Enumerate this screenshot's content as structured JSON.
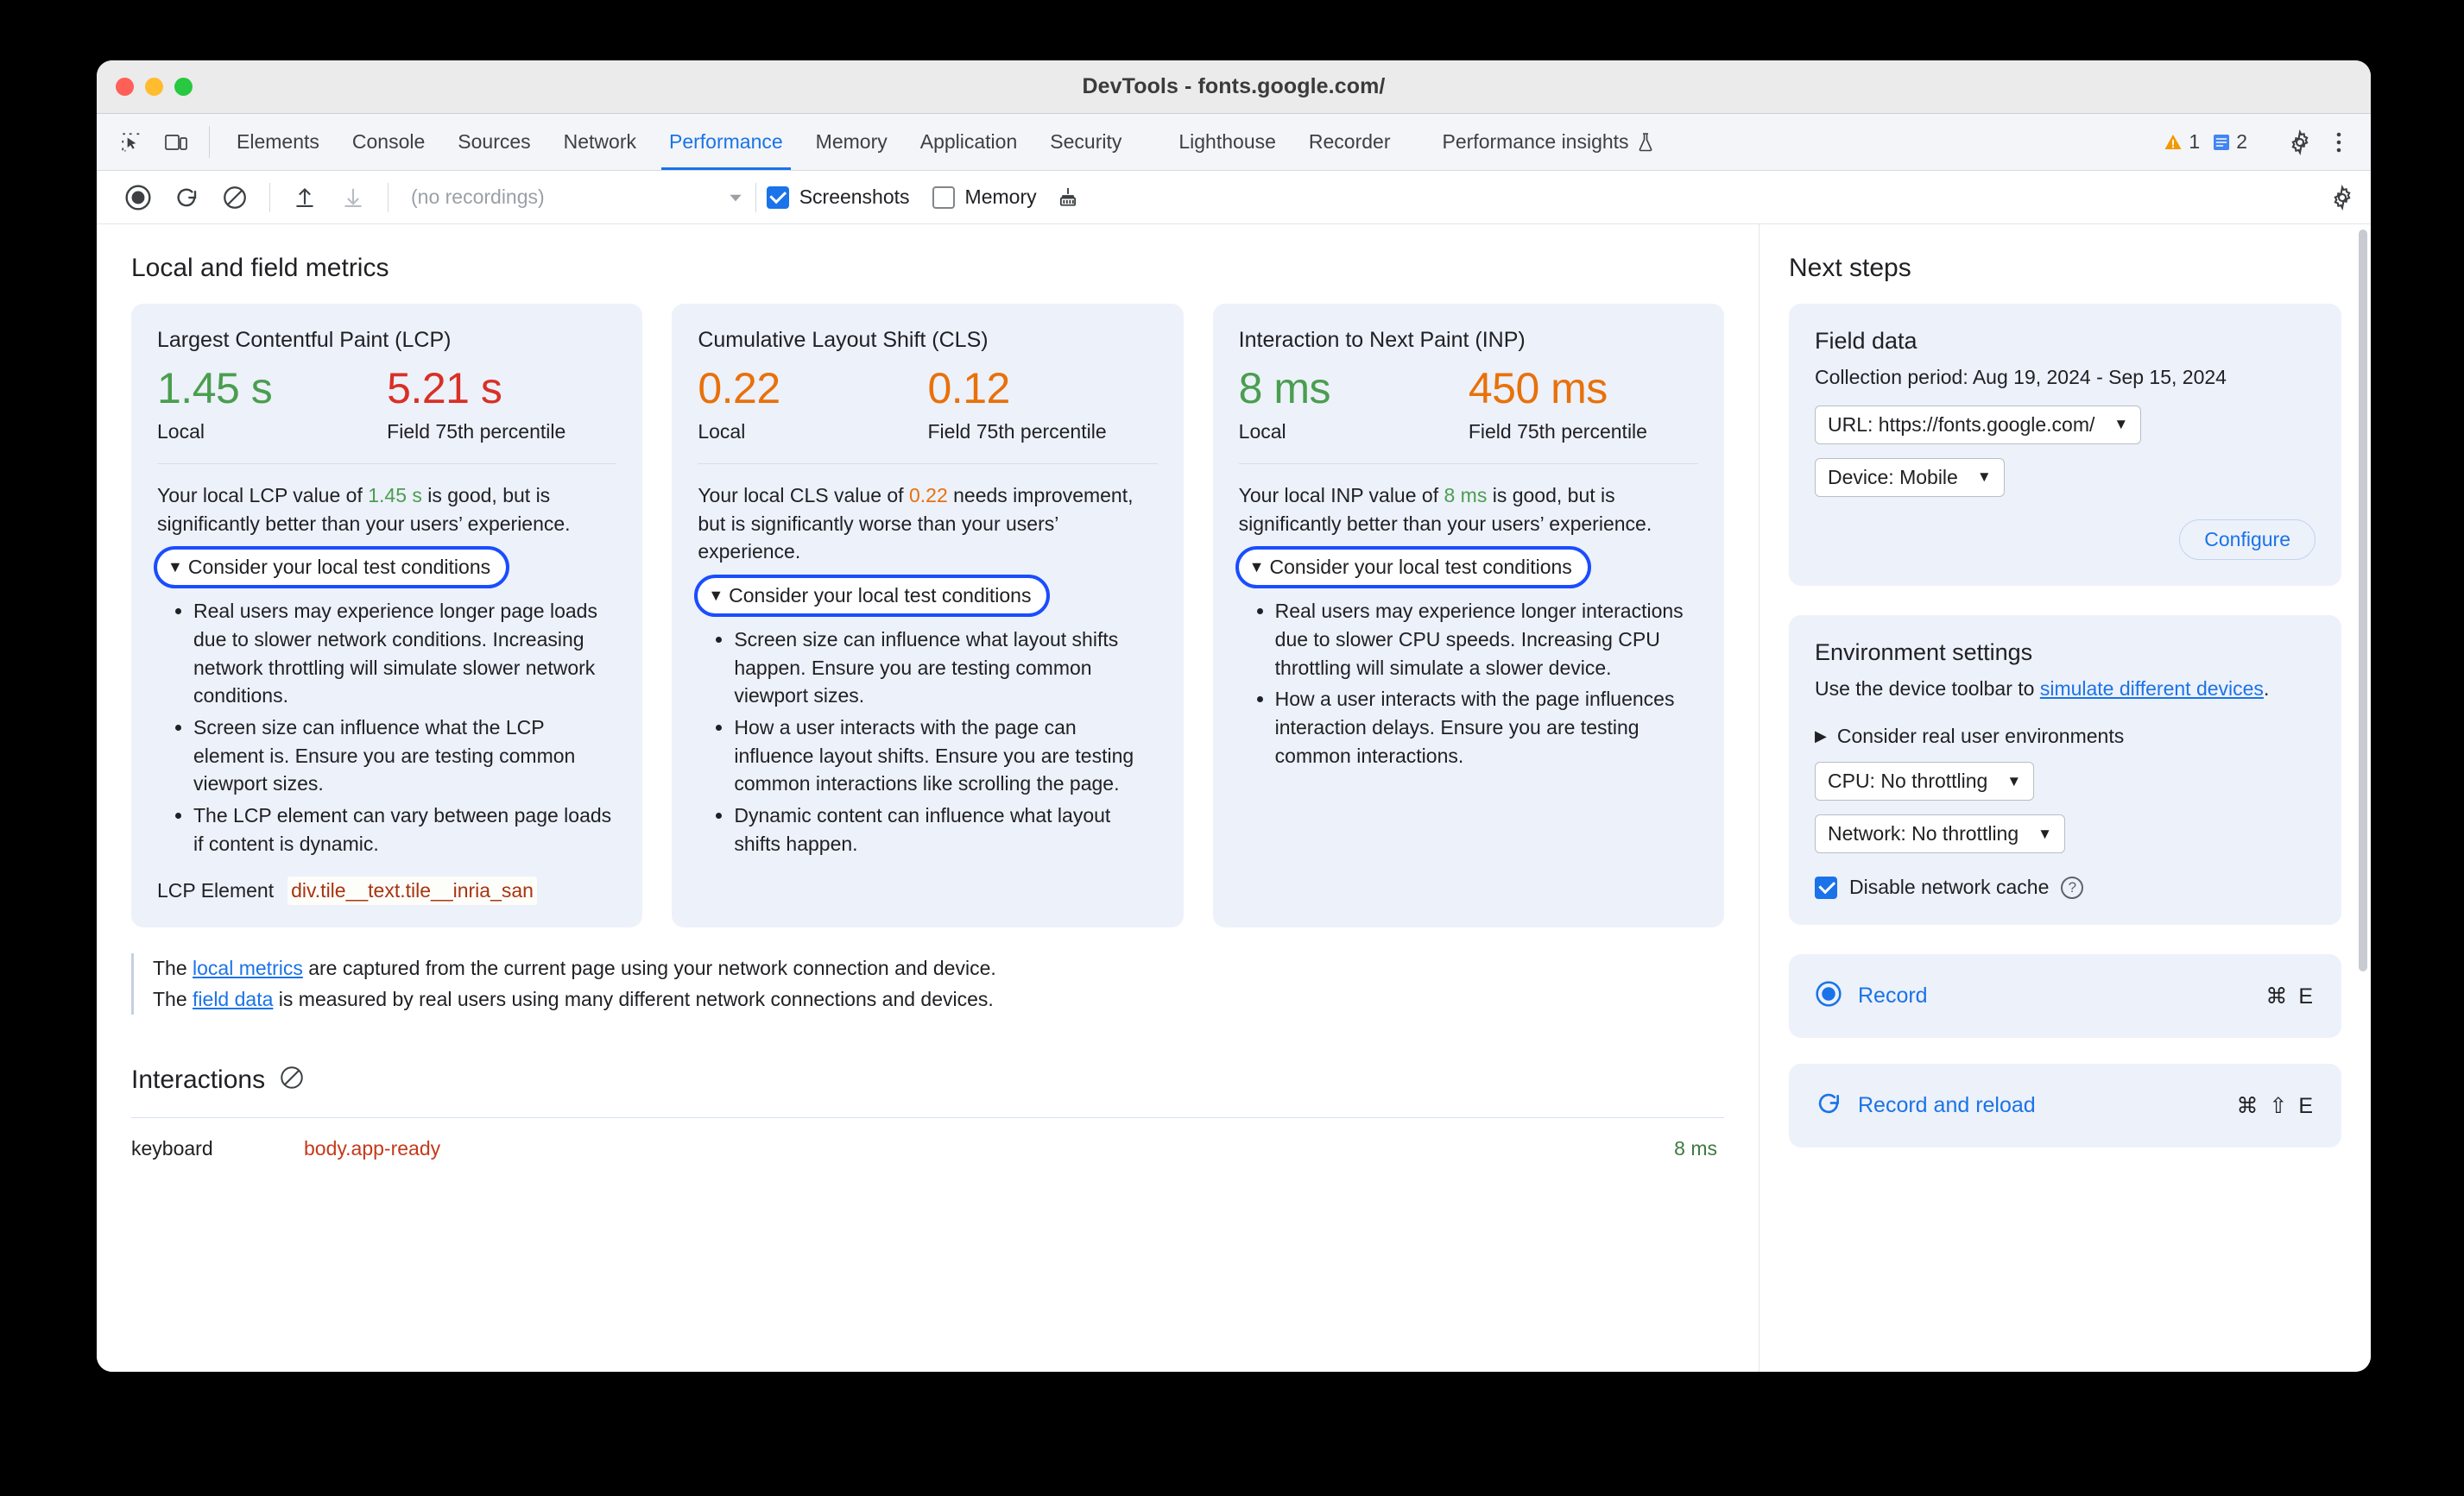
{
  "window": {
    "title": "DevTools - fonts.google.com/"
  },
  "tabs": {
    "items": [
      {
        "label": "Elements",
        "active": false
      },
      {
        "label": "Console",
        "active": false
      },
      {
        "label": "Sources",
        "active": false
      },
      {
        "label": "Network",
        "active": false
      },
      {
        "label": "Performance",
        "active": true
      },
      {
        "label": "Memory",
        "active": false
      },
      {
        "label": "Application",
        "active": false
      },
      {
        "label": "Security",
        "active": false
      },
      {
        "label": "Lighthouse",
        "active": false
      },
      {
        "label": "Recorder",
        "active": false
      },
      {
        "label": "Performance insights",
        "active": false
      }
    ],
    "warning_count": "1",
    "info_count": "2"
  },
  "toolbar": {
    "recordings_placeholder": "(no recordings)",
    "screenshots_label": "Screenshots",
    "screenshots_checked": true,
    "memory_label": "Memory",
    "memory_checked": false
  },
  "main": {
    "section_title": "Local and field metrics",
    "cards": [
      {
        "title": "Largest Contentful Paint (LCP)",
        "local_value": "1.45 s",
        "local_status": "good",
        "local_label": "Local",
        "field_value": "5.21 s",
        "field_status": "bad",
        "field_label": "Field 75th percentile",
        "desc_pre": "Your local LCP value of ",
        "desc_metric": "1.45 s",
        "desc_post": " is good, but is significantly better than your users’ experience.",
        "conditions_summary": "Consider your local test conditions",
        "conditions": [
          "Real users may experience longer page loads due to slower network conditions. Increasing network throttling will simulate slower network conditions.",
          "Screen size can influence what the LCP element is. Ensure you are testing common viewport sizes.",
          "The LCP element can vary between page loads if content is dynamic."
        ],
        "element_label": "LCP Element",
        "element_value": "div.tile__text.tile__inria_san"
      },
      {
        "title": "Cumulative Layout Shift (CLS)",
        "local_value": "0.22",
        "local_status": "warn",
        "local_label": "Local",
        "field_value": "0.12",
        "field_status": "warn",
        "field_label": "Field 75th percentile",
        "desc_pre": "Your local CLS value of ",
        "desc_metric": "0.22",
        "desc_post": " needs improvement, but is significantly worse than your users’ experience.",
        "conditions_summary": "Consider your local test conditions",
        "conditions": [
          "Screen size can influence what layout shifts happen. Ensure you are testing common viewport sizes.",
          "How a user interacts with the page can influence layout shifts. Ensure you are testing common interactions like scrolling the page.",
          "Dynamic content can influence what layout shifts happen."
        ]
      },
      {
        "title": "Interaction to Next Paint (INP)",
        "local_value": "8 ms",
        "local_status": "good",
        "local_label": "Local",
        "field_value": "450 ms",
        "field_status": "warn",
        "field_label": "Field 75th percentile",
        "desc_pre": "Your local INP value of ",
        "desc_metric": "8 ms",
        "desc_post": " is good, but is significantly better than your users’ experience.",
        "conditions_summary": "Consider your local test conditions",
        "conditions": [
          "Real users may experience longer interactions due to slower CPU speeds. Increasing CPU throttling will simulate a slower device.",
          "How a user interacts with the page influences interaction delays. Ensure you are testing common interactions."
        ]
      }
    ],
    "note": {
      "line1_pre": "The ",
      "line1_link": "local metrics",
      "line1_post": " are captured from the current page using your network connection and device.",
      "line2_pre": "The ",
      "line2_link": "field data",
      "line2_post": " is measured by real users using many different network connections and devices."
    },
    "interactions": {
      "title": "Interactions",
      "rows": [
        {
          "type": "keyboard",
          "selector": "body.app-ready",
          "duration": "8 ms"
        }
      ]
    }
  },
  "sidebar": {
    "title": "Next steps",
    "field_data": {
      "heading": "Field data",
      "collection_period": "Collection period: Aug 19, 2024 - Sep 15, 2024",
      "url_select": "URL: https://fonts.google.com/",
      "device_select": "Device: Mobile",
      "configure_label": "Configure"
    },
    "environment": {
      "heading": "Environment settings",
      "desc_pre": "Use the device toolbar to ",
      "desc_link": "simulate different devices",
      "desc_post": ".",
      "real_user_summary": "Consider real user environments",
      "cpu_select": "CPU: No throttling",
      "network_select": "Network: No throttling",
      "cache_label": "Disable network cache",
      "cache_checked": true
    },
    "record": {
      "label": "Record",
      "keys": "⌘ E"
    },
    "record_reload": {
      "label": "Record and reload",
      "keys": "⌘ ⇧ E"
    }
  },
  "colors": {
    "accent": "#1a73e8",
    "good": "#4a9e4f",
    "bad": "#d93025",
    "warn": "#e8710a",
    "card_bg": "#edf1fa",
    "focus_ring": "#1a4dff"
  }
}
